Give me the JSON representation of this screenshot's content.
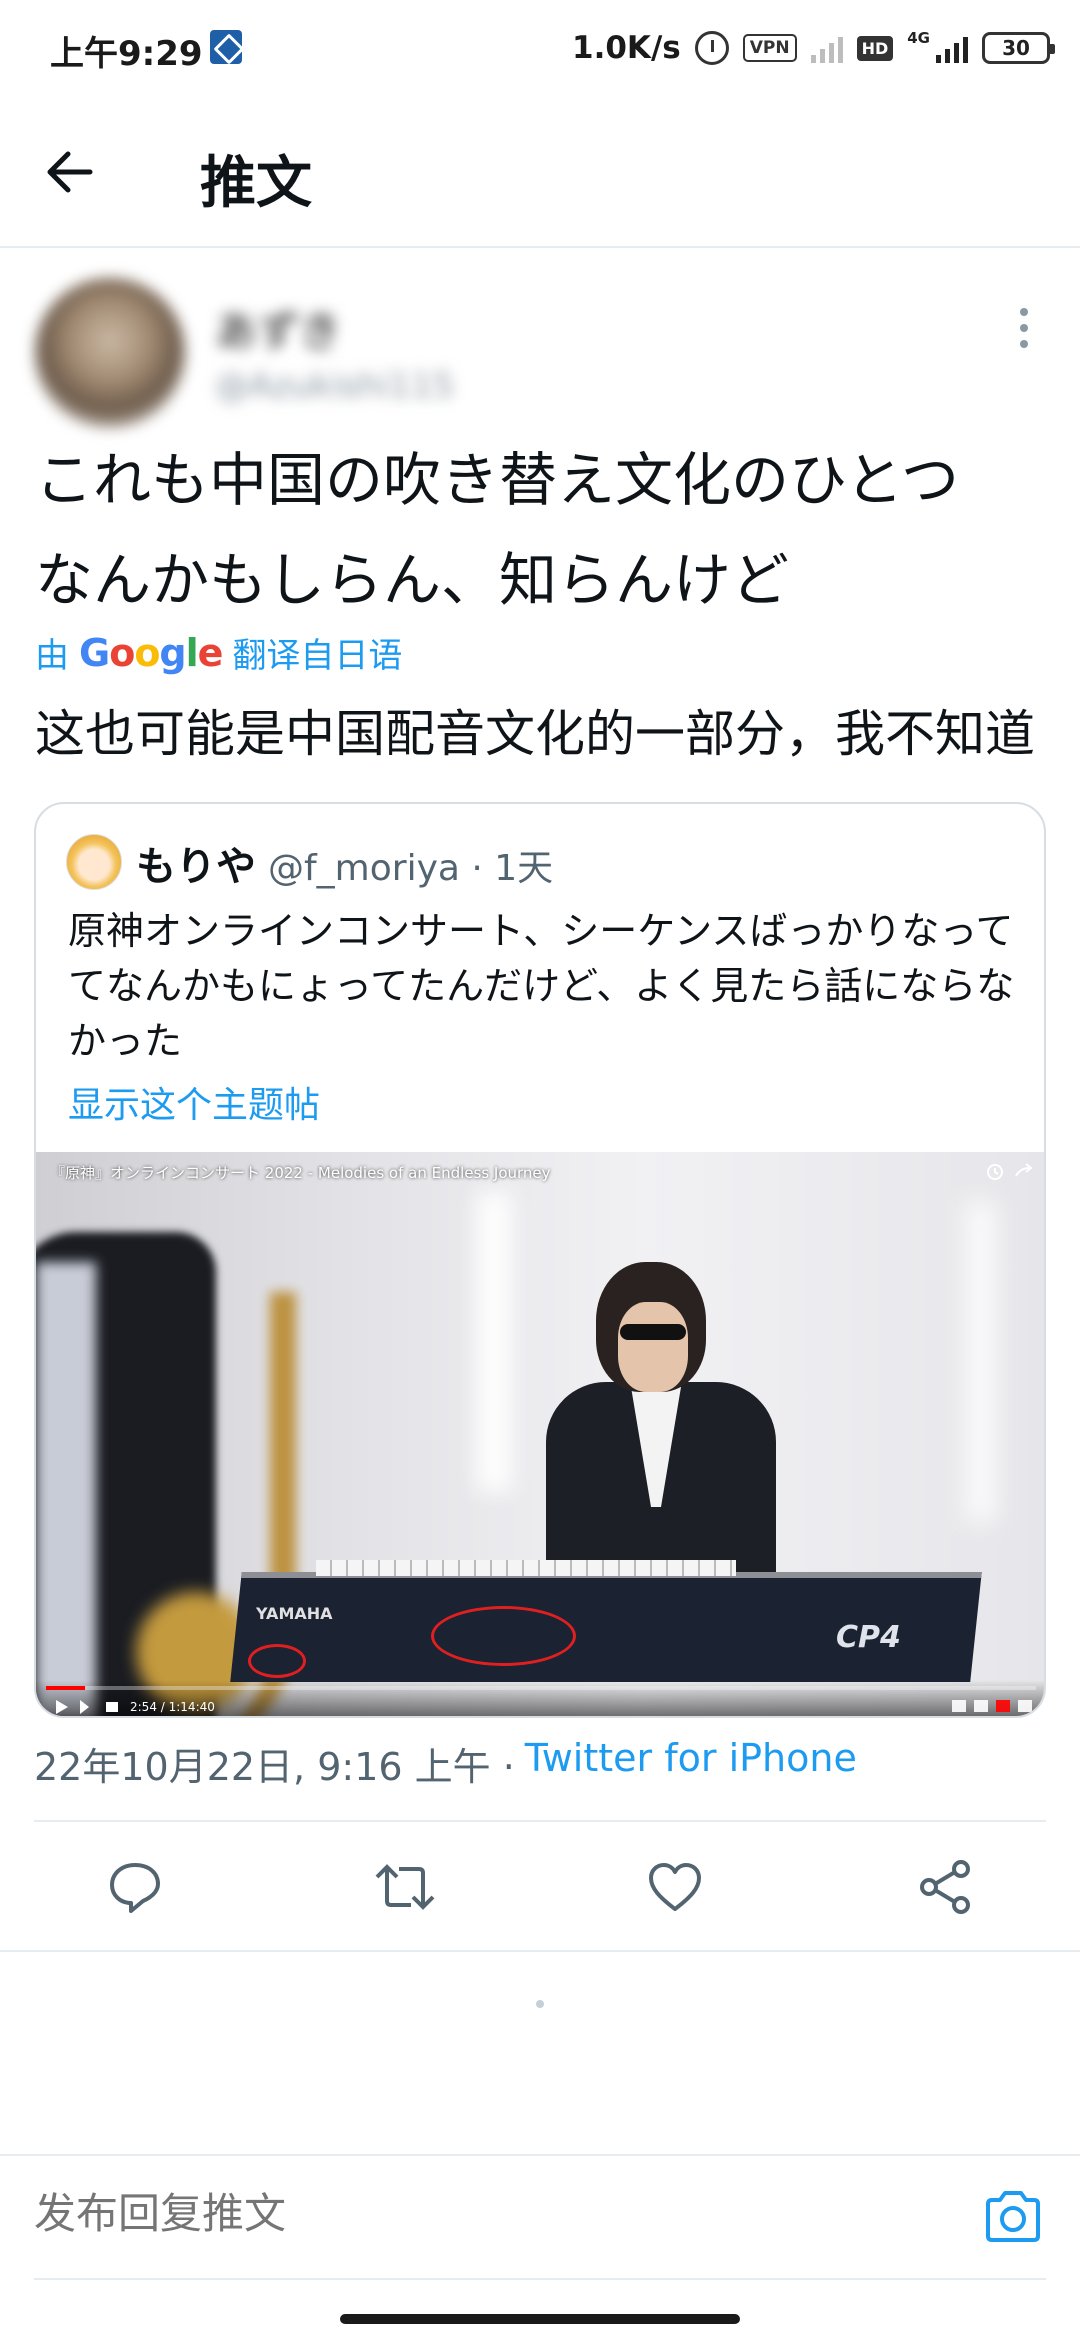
{
  "status_bar": {
    "time": "上午9:29",
    "net_speed": "1.0K/s",
    "vpn": "VPN",
    "hd": "HD",
    "net_type": "4G",
    "battery": "30"
  },
  "header": {
    "title": "推文",
    "back_icon": "arrow-left-icon"
  },
  "tweet": {
    "author_name": "あずき",
    "author_handle": "@Azukishi115",
    "text_line1": "これも中国の吹き替え文化のひとつ",
    "text_line2": "なんかもしらん、知らんけど",
    "translate_prefix": "由",
    "translate_brand": "Google",
    "translate_suffix": "翻译自日语",
    "translated_text": "这也可能是中国配音文化的一部分，我不知道",
    "timestamp": "22年10月22日, 9:16 上午 ·",
    "source": "Twitter for iPhone"
  },
  "quote": {
    "name": "もりや",
    "meta": "@f_moriya · 1天",
    "text": "原神オンラインコンサート、シーケンスばっかりなっててなんかもにょってたんだけど、よく見たら話にならなかった",
    "show_thread": "显示这个主题帖",
    "media": {
      "title": "『原神』オンラインコンサート 2022 - Melodies of an Endless Journey",
      "time": "2:54 / 1:14:40",
      "progress": 0.039,
      "brand_left": "YAMAHA",
      "brand_right": "CP4"
    }
  },
  "actions": [
    {
      "name": "reply",
      "icon": "comment-icon"
    },
    {
      "name": "retweet",
      "icon": "retweet-icon"
    },
    {
      "name": "like",
      "icon": "heart-icon"
    },
    {
      "name": "share",
      "icon": "share-icon"
    }
  ],
  "reply": {
    "placeholder": "发布回复推文"
  },
  "colors": {
    "accent": "#1d9bf0",
    "text": "#0f1419",
    "secondary": "#536471",
    "border": "#e6ecf0"
  }
}
